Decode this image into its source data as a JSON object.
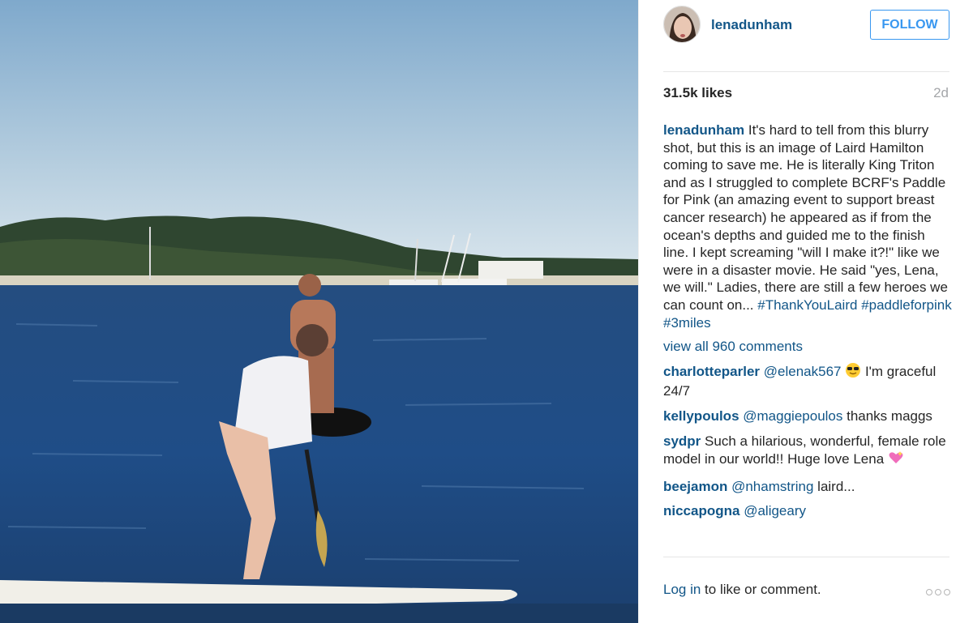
{
  "post": {
    "username": "lenadunham",
    "follow_label": "FOLLOW",
    "likes": "31.5k likes",
    "age": "2d",
    "caption": {
      "user": "lenadunham",
      "text": "It's hard to tell from this blurry shot, but this is an image of Laird Hamilton coming to save me. He is literally King Triton and as I struggled to complete BCRF's Paddle for Pink (an amazing event to support breast cancer research) he appeared as if from the ocean's depths and guided me to the finish line. I kept screaming \"will I make it?!\" like we were in a disaster movie. He said \"yes, Lena, we will.\" Ladies, there are still a few heroes we can count on... ",
      "hashtags": [
        "#ThankYouLaird",
        "#paddleforpink",
        "#3miles"
      ]
    },
    "view_all": "view all 960 comments",
    "comments": [
      {
        "user": "charlotteparler",
        "mention": "@elenak567",
        "emoji": "sunglasses-emoji",
        "text": " I'm graceful 24/7"
      },
      {
        "user": "kellypoulos",
        "mention": "@maggiepoulos",
        "text": " thanks maggs"
      },
      {
        "user": "sydpr",
        "text": "Such a hilarious, wonderful, female role model in our world!! Huge love Lena ",
        "emoji": "sparkling-heart-emoji"
      },
      {
        "user": "beejamon",
        "mention": "@nhamstring",
        "text": " laird..."
      },
      {
        "user": "niccapogna",
        "mention": "@aligeary",
        "text": ""
      }
    ],
    "footer": {
      "login_link": "Log in",
      "login_text": " to like or comment."
    },
    "more_icon": "more-options-icon",
    "colors": {
      "link": "#125688",
      "follow": "#3897f0",
      "muted": "#a5a7aa"
    }
  }
}
